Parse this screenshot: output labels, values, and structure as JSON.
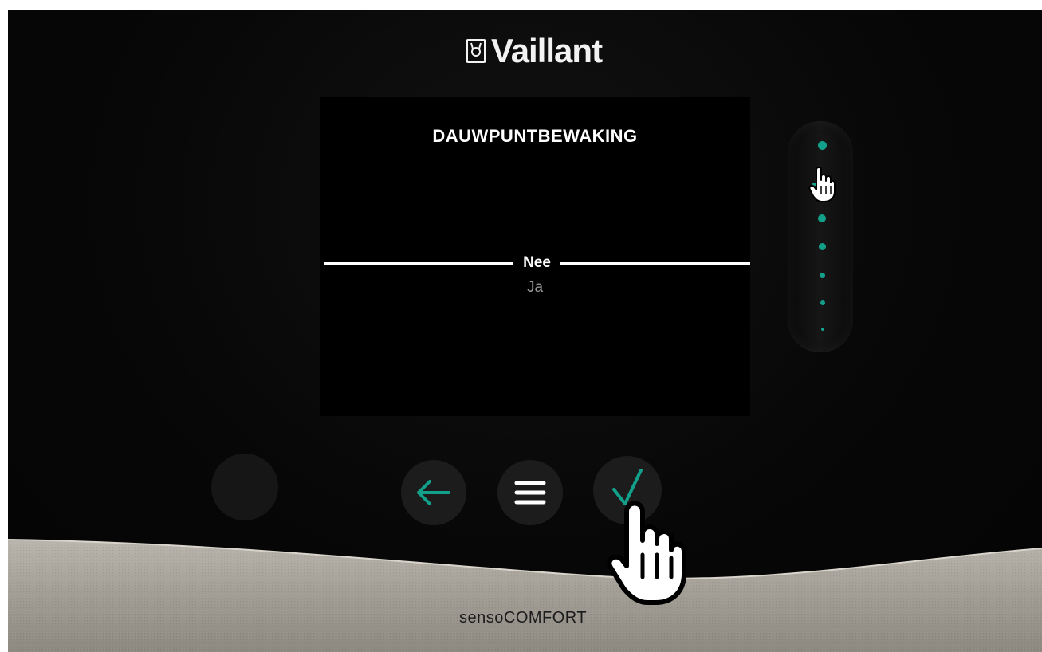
{
  "device": {
    "logo_text": "Vaillant",
    "model": "sensoCOMFORT"
  },
  "screen": {
    "title": "DAUWPUNTBEWAKING",
    "options": [
      {
        "label": "Nee",
        "selected": true
      },
      {
        "label": "Ja",
        "selected": false
      }
    ]
  },
  "scroll_indicator": {
    "position_index": 1,
    "steps": 7
  },
  "buttons": [
    {
      "name": "blank-button",
      "icon": "none"
    },
    {
      "name": "back-button",
      "icon": "arrow-left-icon"
    },
    {
      "name": "menu-button",
      "icon": "menu-icon"
    },
    {
      "name": "confirm-button",
      "icon": "check-icon"
    }
  ],
  "colors": {
    "accent": "#13a08a",
    "text": "#ffffff",
    "muted": "#9a9a9a",
    "bezel": "#a8a49c"
  }
}
